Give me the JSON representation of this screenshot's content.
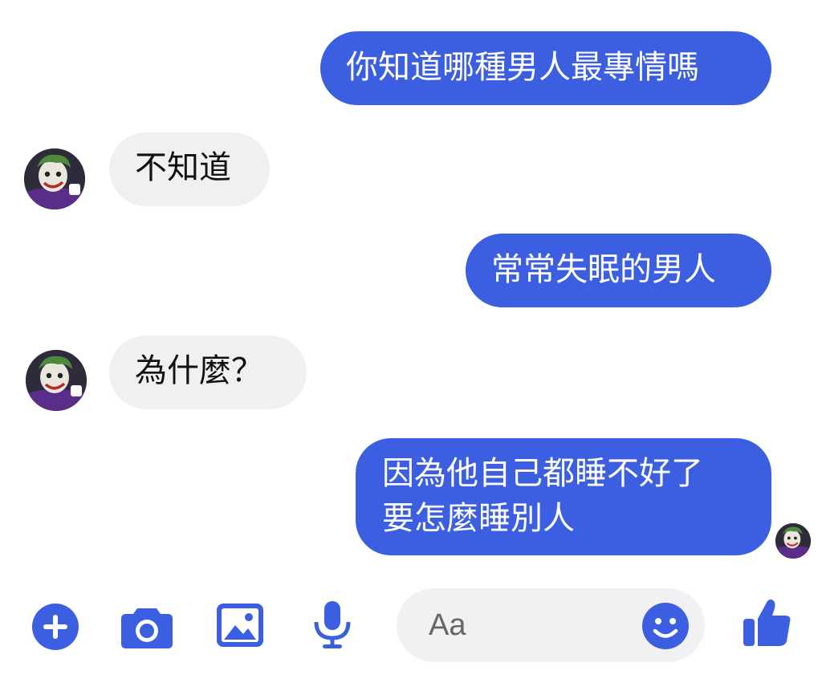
{
  "conversation": {
    "messages": [
      {
        "direction": "outgoing",
        "lines": [
          "你知道哪種男人最專情嗎"
        ]
      },
      {
        "direction": "incoming",
        "lines": [
          "不知道"
        ]
      },
      {
        "direction": "outgoing",
        "lines": [
          "常常失眠的男人"
        ]
      },
      {
        "direction": "incoming",
        "lines": [
          "為什麼？"
        ]
      },
      {
        "direction": "outgoing",
        "lines": [
          "因為他自己都睡不好了",
          "要怎麼睡別人"
        ]
      }
    ]
  },
  "composer": {
    "placeholder": "Aa",
    "toolbar_icons": [
      "plus-icon",
      "camera-icon",
      "image-icon",
      "microphone-icon",
      "smiley-icon",
      "thumbs-up-icon"
    ]
  },
  "colors": {
    "outgoing_bubble": "#3b5fe0",
    "incoming_bubble": "#f0f0f0",
    "accent": "#3b5fe0",
    "composer_background": "#f1f1f3"
  },
  "icons": {
    "avatar": "joker-avatar-icon",
    "read_receipt": "read-receipt-avatar-icon"
  }
}
